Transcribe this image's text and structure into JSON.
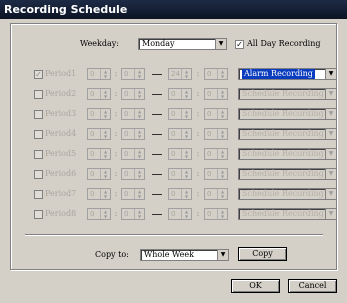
{
  "window": {
    "title": "Recording Schedule"
  },
  "weekday": {
    "label": "Weekday:",
    "value": "Monday"
  },
  "all_day": {
    "label": "All Day Recording",
    "checked": true
  },
  "periods": [
    {
      "label": "Period1",
      "checked": true,
      "start_h": "0",
      "start_m": "0",
      "end_h": "24",
      "end_m": "0",
      "type": "Alarm Recording",
      "enabled": true
    },
    {
      "label": "Period2",
      "checked": false,
      "start_h": "0",
      "start_m": "0",
      "end_h": "0",
      "end_m": "0",
      "type": "Schedule Recording",
      "enabled": false
    },
    {
      "label": "Period3",
      "checked": false,
      "start_h": "0",
      "start_m": "0",
      "end_h": "0",
      "end_m": "0",
      "type": "Schedule Recording",
      "enabled": false
    },
    {
      "label": "Period4",
      "checked": false,
      "start_h": "0",
      "start_m": "0",
      "end_h": "0",
      "end_m": "0",
      "type": "Schedule Recording",
      "enabled": false
    },
    {
      "label": "Period5",
      "checked": false,
      "start_h": "0",
      "start_m": "0",
      "end_h": "0",
      "end_m": "0",
      "type": "Schedule Recording",
      "enabled": false
    },
    {
      "label": "Period6",
      "checked": false,
      "start_h": "0",
      "start_m": "0",
      "end_h": "0",
      "end_m": "0",
      "type": "Schedule Recording",
      "enabled": false
    },
    {
      "label": "Period7",
      "checked": false,
      "start_h": "0",
      "start_m": "0",
      "end_h": "0",
      "end_m": "0",
      "type": "Schedule Recording",
      "enabled": false
    },
    {
      "label": "Period8",
      "checked": false,
      "start_h": "0",
      "start_m": "0",
      "end_h": "0",
      "end_m": "0",
      "type": "Schedule Recording",
      "enabled": false
    }
  ],
  "colon": ":",
  "copy": {
    "label": "Copy to:",
    "target": "Whole Week",
    "button": "Copy"
  },
  "buttons": {
    "ok": "OK",
    "cancel": "Cancel"
  },
  "icons": {
    "dropdown": "triangle-down",
    "spin_up": "triangle-up",
    "spin_down": "triangle-down"
  }
}
